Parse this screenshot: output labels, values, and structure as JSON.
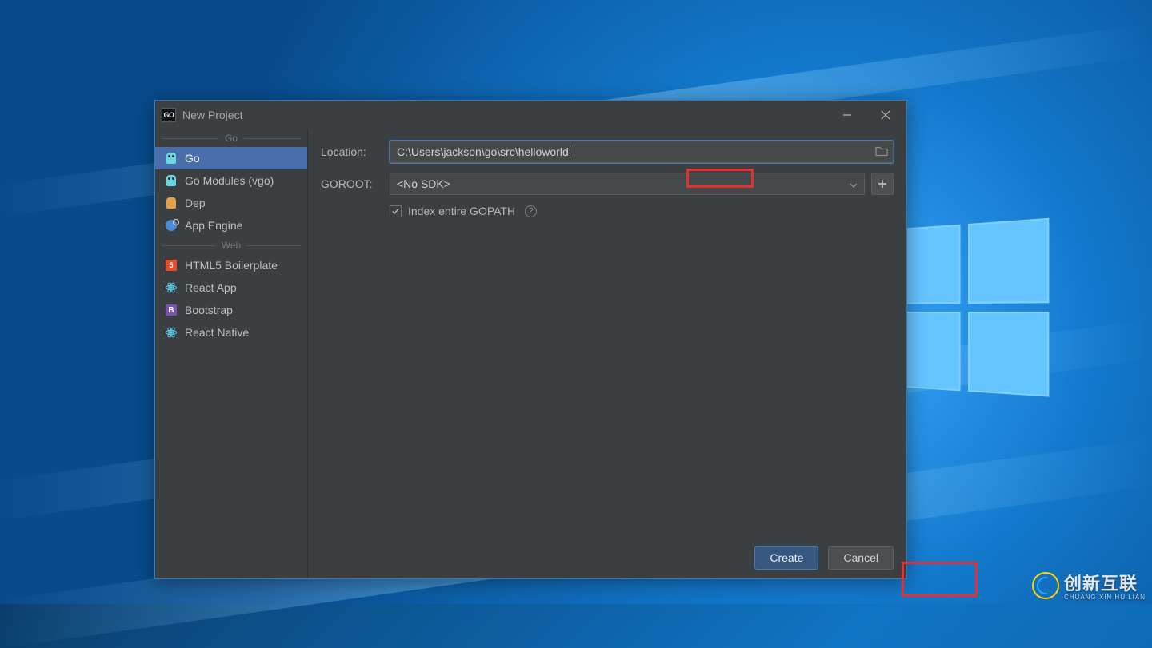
{
  "dialog": {
    "title": "New Project",
    "app_icon_text": "GO",
    "sections": {
      "go_label": "Go",
      "web_label": "Web"
    },
    "sidebar": {
      "go": [
        {
          "label": "Go",
          "icon": "gopher-icon",
          "selected": true
        },
        {
          "label": "Go Modules (vgo)",
          "icon": "gopher-icon",
          "selected": false
        },
        {
          "label": "Dep",
          "icon": "dep-icon",
          "selected": false
        },
        {
          "label": "App Engine",
          "icon": "appengine-icon",
          "selected": false
        }
      ],
      "web": [
        {
          "label": "HTML5 Boilerplate",
          "icon": "html5-icon"
        },
        {
          "label": "React App",
          "icon": "react-icon"
        },
        {
          "label": "Bootstrap",
          "icon": "bootstrap-icon"
        },
        {
          "label": "React Native",
          "icon": "react-icon"
        }
      ]
    },
    "form": {
      "location_label": "Location:",
      "location_prefix": "C:\\Users\\jackson\\go\\src\\",
      "location_suffix": "helloworld",
      "goroot_label": "GOROOT:",
      "goroot_value": "<No SDK>",
      "index_checkbox_label": "Index entire GOPATH",
      "index_checked": true
    },
    "buttons": {
      "create": "Create",
      "cancel": "Cancel"
    }
  },
  "watermark": {
    "zh": "创新互联",
    "py": "CHUANG XIN HU LIAN"
  },
  "colors": {
    "dialog_bg": "#3c3f41",
    "accent_blue": "#4a6ea9",
    "highlight_red": "#e53030"
  }
}
